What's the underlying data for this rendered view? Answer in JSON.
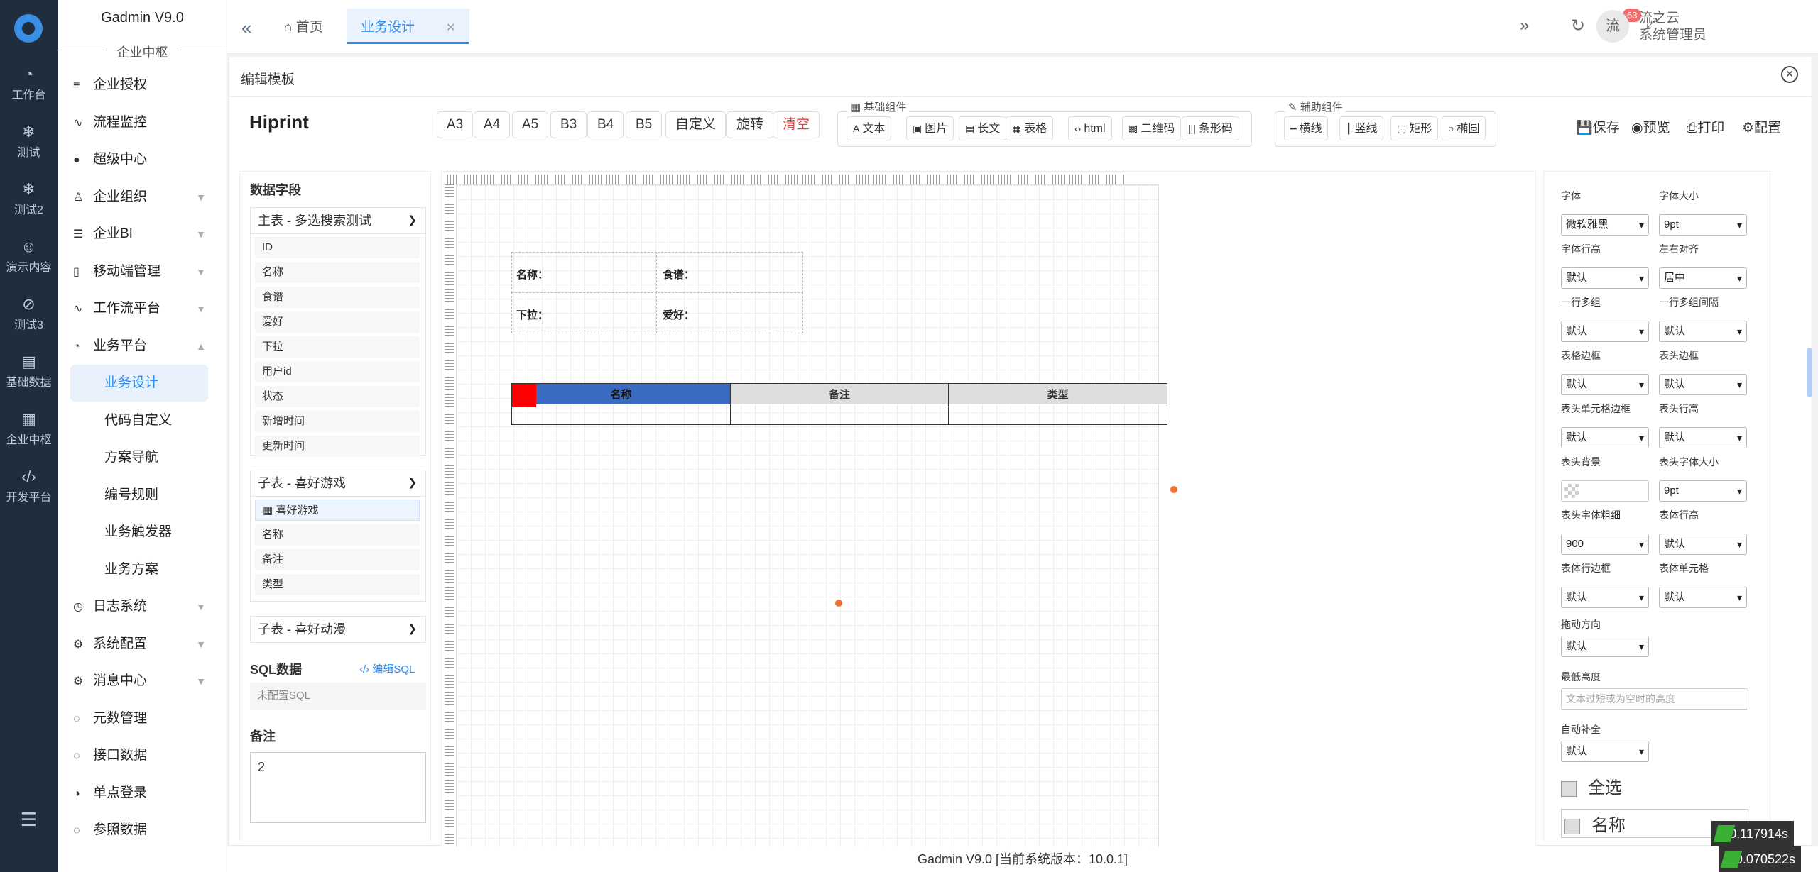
{
  "rail": {
    "items": [
      {
        "label": "工作台",
        "icon": "gauge-icon",
        "glyph": "◔"
      },
      {
        "label": "测试",
        "icon": "snowflake-icon",
        "glyph": "❄"
      },
      {
        "label": "测试2",
        "icon": "snowflake-icon",
        "glyph": "❄"
      },
      {
        "label": "演示内容",
        "icon": "smile-icon",
        "glyph": "☺"
      },
      {
        "label": "测试3",
        "icon": "compass-icon",
        "glyph": "⊘"
      },
      {
        "label": "基础数据",
        "icon": "clipboard-icon",
        "glyph": "▤"
      },
      {
        "label": "企业中枢",
        "icon": "grid-plus-icon",
        "glyph": "▦"
      },
      {
        "label": "开发平台",
        "icon": "code-icon",
        "glyph": "‹/›"
      }
    ]
  },
  "sidebar": {
    "brand": "Gadmin V9.0",
    "divider": "企业中枢",
    "items": [
      {
        "label": "企业授权",
        "glyph": "≡",
        "arrow": ""
      },
      {
        "label": "流程监控",
        "glyph": "∿",
        "arrow": ""
      },
      {
        "label": "超级中心",
        "glyph": "●",
        "arrow": ""
      },
      {
        "label": "企业组织",
        "glyph": "♙",
        "arrow": "▼"
      },
      {
        "label": "企业BI",
        "glyph": "☰",
        "arrow": "▼"
      },
      {
        "label": "移动端管理",
        "glyph": "▯",
        "arrow": "▼"
      },
      {
        "label": "工作流平台",
        "glyph": "∿",
        "arrow": "▼"
      },
      {
        "label": "业务平台",
        "glyph": "◔",
        "arrow": "▲"
      }
    ],
    "subitems": [
      "业务设计",
      "代码自定义",
      "方案导航",
      "编号规则",
      "业务触发器",
      "业务方案"
    ],
    "items2": [
      {
        "label": "日志系统",
        "glyph": "◷",
        "arrow": "▼"
      },
      {
        "label": "系统配置",
        "glyph": "⚙",
        "arrow": "▼"
      },
      {
        "label": "消息中心",
        "glyph": "⚙",
        "arrow": "▼"
      },
      {
        "label": "元数管理",
        "glyph": "◌",
        "arrow": ""
      },
      {
        "label": "接口数据",
        "glyph": "◌",
        "arrow": ""
      },
      {
        "label": "单点登录",
        "glyph": "◑",
        "arrow": ""
      },
      {
        "label": "参照数据",
        "glyph": "◌",
        "arrow": ""
      }
    ]
  },
  "topbar": {
    "home_tab": "首页",
    "active_tab": "业务设计",
    "badge": "63",
    "avatar": "流",
    "user_line1": "流之云",
    "user_line2": "系统管理员"
  },
  "panel": {
    "title": "编辑模板"
  },
  "toolbar": {
    "brand": "Hiprint",
    "paper_buttons": [
      "A3",
      "A4",
      "A5",
      "B3",
      "B4",
      "B5",
      "自定义",
      "旋转",
      "清空"
    ],
    "basic_label": "基础组件",
    "basic": [
      {
        "label": "文本",
        "glyph": "A"
      },
      {
        "label": "图片",
        "glyph": "▣"
      },
      {
        "label": "长文",
        "glyph": "▤"
      },
      {
        "label": "表格",
        "glyph": "▦"
      },
      {
        "label": "html",
        "glyph": "‹›"
      },
      {
        "label": "二维码",
        "glyph": "▩"
      },
      {
        "label": "条形码",
        "glyph": "|||"
      }
    ],
    "aux_label": "辅助组件",
    "aux": [
      {
        "label": "横线",
        "glyph": "━"
      },
      {
        "label": "竖线",
        "glyph": "┃"
      },
      {
        "label": "矩形",
        "glyph": "▢"
      },
      {
        "label": "椭圆",
        "glyph": "○"
      }
    ],
    "actions": [
      {
        "label": "保存",
        "glyph": "💾"
      },
      {
        "label": "预览",
        "glyph": "◉"
      },
      {
        "label": "打印",
        "glyph": "⎙"
      },
      {
        "label": "配置",
        "glyph": "⚙"
      }
    ]
  },
  "left": {
    "title": "数据字段",
    "main_section": "主表 - 多选搜索测试",
    "main_fields": [
      "ID",
      "名称",
      "食谱",
      "爱好",
      "下拉",
      "用户id",
      "状态",
      "新增时间",
      "更新时间"
    ],
    "sub1": "子表 - 喜好游戏",
    "sub1_fields": [
      "喜好游戏",
      "名称",
      "备注",
      "类型"
    ],
    "sub2": "子表 - 喜好动漫",
    "sql_title": "SQL数据",
    "sql_link": "编辑SQL",
    "sql_value": "未配置SQL",
    "note_title": "备注",
    "note_value": "2"
  },
  "canvas": {
    "labels": [
      "名称：",
      "食谱：",
      "下拉：",
      "爱好："
    ],
    "table_headers": [
      "名称",
      "备注",
      "类型"
    ]
  },
  "right": {
    "rows": [
      [
        {
          "label": "字体",
          "value": "微软雅黑"
        },
        {
          "label": "字体大小",
          "value": "9pt"
        }
      ],
      [
        {
          "label": "字体行高",
          "value": "默认"
        },
        {
          "label": "左右对齐",
          "value": "居中"
        }
      ],
      [
        {
          "label": "一行多组",
          "value": "默认"
        },
        {
          "label": "一行多组间隔",
          "value": "默认"
        }
      ],
      [
        {
          "label": "表格边框",
          "value": "默认"
        },
        {
          "label": "表头边框",
          "value": "默认"
        }
      ],
      [
        {
          "label": "表头单元格边框",
          "value": "默认"
        },
        {
          "label": "表头行高",
          "value": "默认"
        }
      ],
      [
        {
          "label": "表头背景",
          "value": ""
        },
        {
          "label": "表头字体大小",
          "value": "9pt"
        }
      ],
      [
        {
          "label": "表头字体粗细",
          "value": "900"
        },
        {
          "label": "表体行高",
          "value": "默认"
        }
      ],
      [
        {
          "label": "表体行边框",
          "value": "默认"
        },
        {
          "label": "表体单元格",
          "value": "默认"
        }
      ]
    ],
    "drag_label": "拖动方向",
    "drag_value": "默认",
    "minh_label": "最低高度",
    "minh_placeholder": "文本过短或为空时的高度",
    "autofill_label": "自动补全",
    "autofill_value": "默认",
    "select_all": "全选",
    "col_name": "名称"
  },
  "footer": {
    "text": "Gadmin V9.0 [当前系统版本：10.0.1]"
  },
  "perf": [
    "0.117914s",
    "0.070522s"
  ]
}
